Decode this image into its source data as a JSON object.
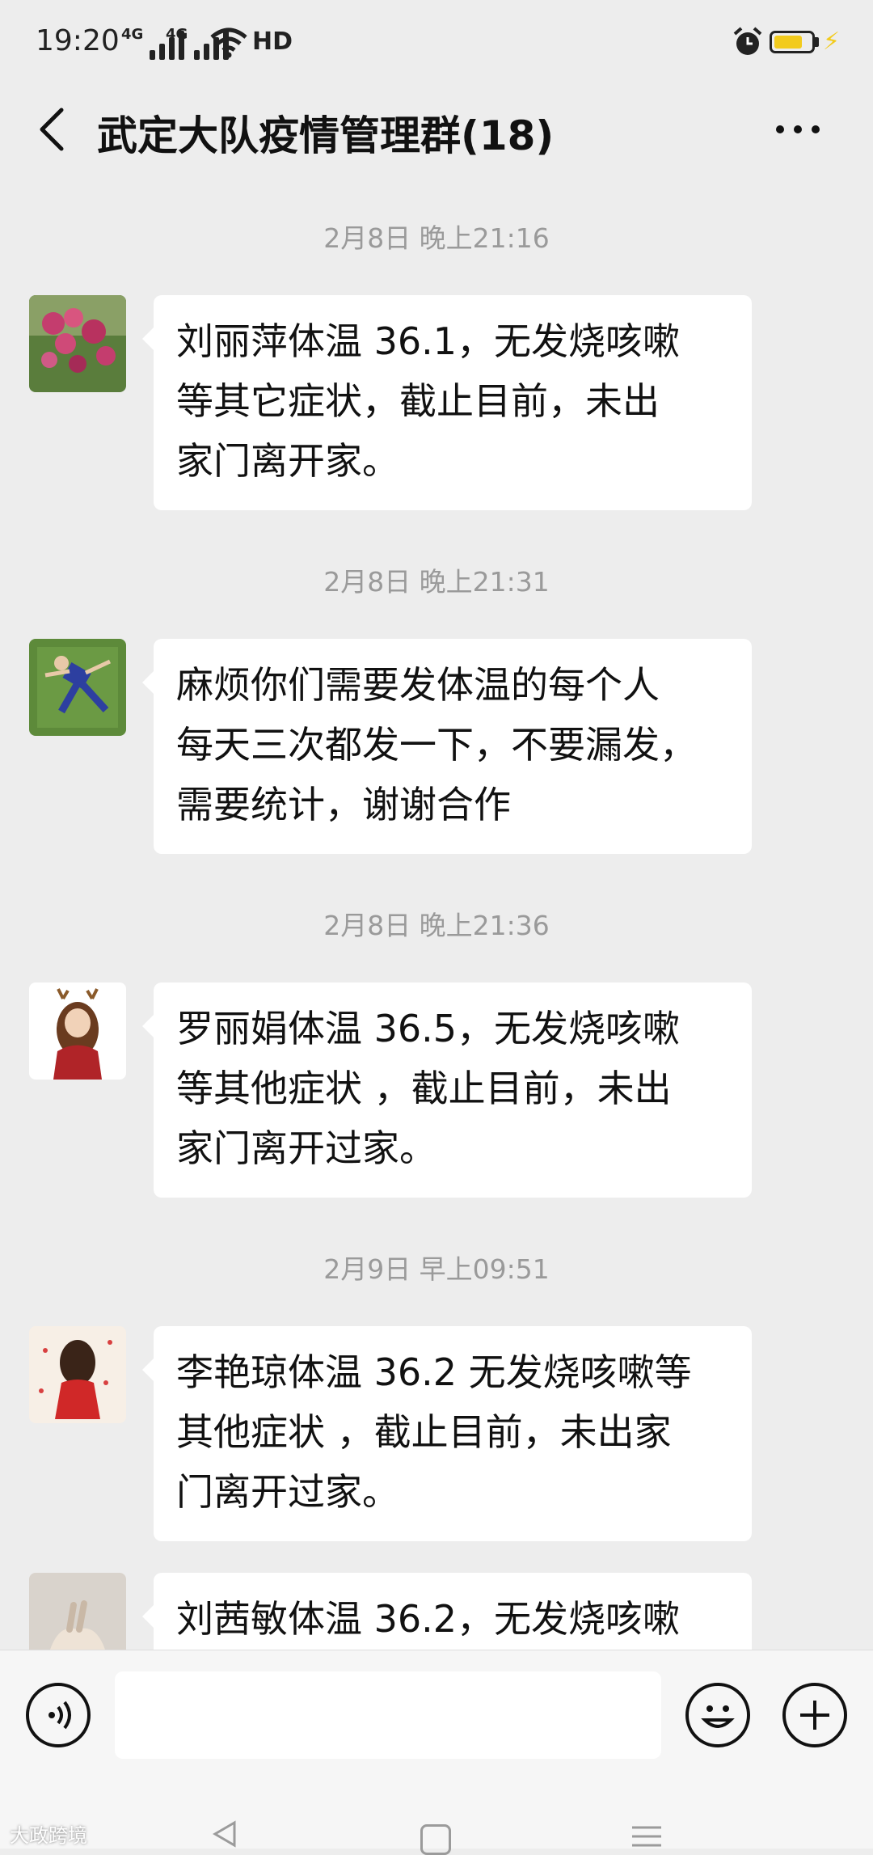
{
  "status": {
    "time": "19:20",
    "network1": "4G",
    "network2": "4G",
    "hd_label": "HD",
    "battery_percent": 0.78,
    "colors": {
      "battery": "#f2cb1d"
    }
  },
  "header": {
    "title": "武定大队疫情管理群(18)",
    "back_icon": "chevron-left-icon",
    "more_icon": "more-dots-icon"
  },
  "messages": [
    {
      "timestamp": "2月8日 晚上21:16",
      "lines": [
        "刘丽萍体温 36.1，无发烧咳嗽",
        "等其它症状，截止目前，未出",
        "家门离开家。"
      ],
      "avatar": "flower-avatar"
    },
    {
      "timestamp": "2月8日 晚上21:31",
      "lines": [
        "麻烦你们需要发体温的每个人",
        "每天三次都发一下，不要漏发，",
        "需要统计，谢谢合作"
      ],
      "avatar": "person-on-grass-avatar"
    },
    {
      "timestamp": "2月8日 晚上21:36",
      "lines": [
        "罗丽娟体温 36.5，无发烧咳嗽",
        "等其他症状 ，截止目前，未出",
        "家门离开过家。"
      ],
      "avatar": "girl-with-antlers-avatar"
    },
    {
      "timestamp": "2月9日 早上09:51",
      "lines": [
        "李艳琼体温 36.2 无发烧咳嗽等",
        "其他症状 ，截止目前，未出家",
        "门离开过家。"
      ],
      "avatar": "girl-red-dress-avatar"
    },
    {
      "timestamp": "",
      "lines": [
        "刘茜敏体温 36.2，无发烧咳嗽"
      ],
      "avatar": "hand-avatar"
    }
  ],
  "input": {
    "placeholder": "",
    "voice_icon": "voice-icon",
    "emoji_icon": "emoji-icon",
    "plus_icon": "plus-icon"
  },
  "watermark": "大政跨境"
}
